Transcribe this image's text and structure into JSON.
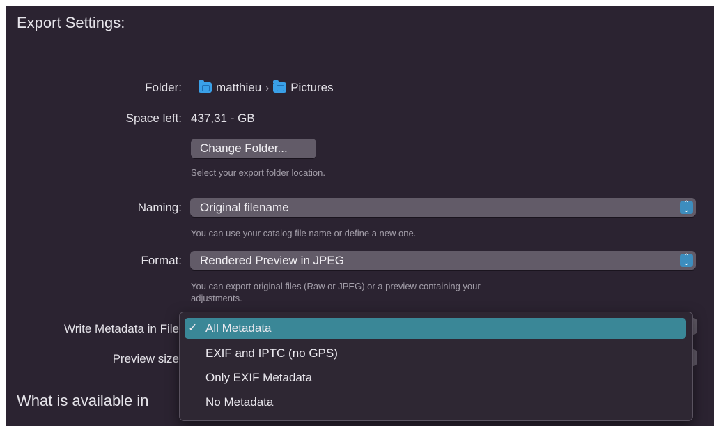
{
  "title": "Export Settings:",
  "folder": {
    "label": "Folder:",
    "path": [
      {
        "name": "matthieu",
        "icon": "home-folder-icon"
      },
      {
        "name": "Pictures",
        "icon": "pictures-folder-icon"
      }
    ],
    "separator": "›"
  },
  "space": {
    "label": "Space left:",
    "value": "437,31 - GB"
  },
  "change_folder": {
    "label": "Change Folder...",
    "hint": "Select your export folder location."
  },
  "naming": {
    "label": "Naming:",
    "value": "Original filename",
    "hint": "You can use your catalog file name or define a new one."
  },
  "format": {
    "label": "Format:",
    "value": "Rendered Preview in JPEG",
    "hint_line1": "You can export original files (Raw or JPEG) or a preview containing your",
    "hint_line2": "adjustments."
  },
  "metadata": {
    "label": "Write Metadata in File",
    "options": [
      "All Metadata",
      "EXIF and IPTC (no GPS)",
      "Only EXIF Metadata",
      "No Metadata"
    ],
    "selected_index": 0,
    "check": "✓"
  },
  "preview_size": {
    "label": "Preview size"
  },
  "section2_title": "What is available in",
  "colors": {
    "background": "#2b2331",
    "control": "#625b68",
    "accent": "#3d8dbe",
    "menu_highlight": "#3a8797"
  }
}
